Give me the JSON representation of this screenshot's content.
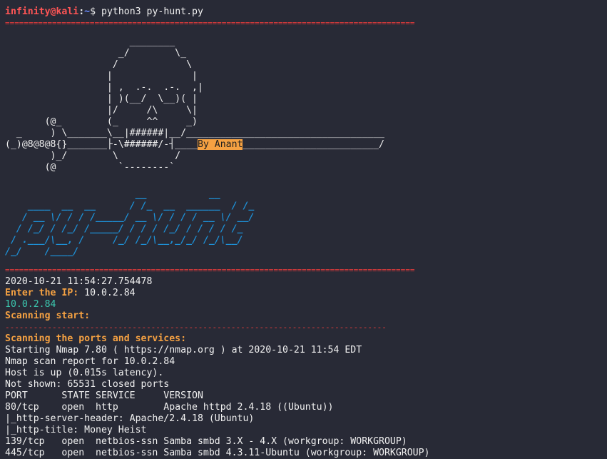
{
  "prompt": {
    "user_host": "infinity@kali",
    "separator": ":",
    "path": "~",
    "symbol": "$ ",
    "command": "python3 py-hunt.py"
  },
  "separator_line": "=======================================================================================",
  "skull_art": {
    "l1": "                      ________",
    "l2": "                    _/        \\_",
    "l3": "                   /            \\",
    "l4": "                  |              |",
    "l5": "                  | ,  .-.  .-.  ,|",
    "l6": "                  | )(__/  \\__)( |",
    "l7": "                  |/     /\\     \\|",
    "l8": "       (@_        (_     ^^     _)",
    "l9_left": "  _     ) \\_______\\__|######|__/_",
    "l9_right": "__________________________________",
    "l10_left": "(_)@8@8@8{}_______├-\\######/-┤____",
    "by_label": "By Anant",
    "l10_right": "________________________/",
    "l11": "        )_/        \\          /",
    "l12": "       (@           `--------`"
  },
  "logo_art": {
    "l1": "                       __           __",
    "l2": "    ____  __  __      / /_  __  ______  / /_",
    "l3": "   / __ \\/ / / /_____/ __ \\/ / / / __ \\/ __/",
    "l4": "  / /_/ / /_/ /_____/ / / / /_/ / / / / /_",
    "l5": " / .___/\\__, /     /_/ /_/\\__,_/_/ /_/\\__/",
    "l6": "/_/    /____/"
  },
  "output": {
    "timestamp": "2020-10-21 11:54:27.754478",
    "enter_ip_label": "Enter the IP:",
    "entered_ip": " 10.0.2.84",
    "echo_ip": "10.0.2.84",
    "scanning_start": "Scanning start:",
    "dash_line": "---------------------------------------------------------------------------------",
    "scanning_ports": "Scanning the ports and services:",
    "nmap_lines": [
      "Starting Nmap 7.80 ( https://nmap.org ) at 2020-10-21 11:54 EDT",
      "Nmap scan report for 10.0.2.84",
      "Host is up (0.015s latency).",
      "Not shown: 65531 closed ports",
      "PORT      STATE SERVICE     VERSION",
      "80/tcp    open  http        Apache httpd 2.4.18 ((Ubuntu))",
      "|_http-server-header: Apache/2.4.18 (Ubuntu)",
      "|_http-title: Money Heist",
      "139/tcp   open  netbios-ssn Samba smbd 3.X - 4.X (workgroup: WORKGROUP)",
      "445/tcp   open  netbios-ssn Samba smbd 4.3.11-Ubuntu (workgroup: WORKGROUP)"
    ]
  },
  "colors": {
    "background": "#282a36",
    "text": "#f0f0f0",
    "prompt_user": "#ff5555",
    "prompt_path": "#6b8cff",
    "separator": "#e23b3b",
    "accent_orange": "#f5a142",
    "accent_teal": "#3cc9b0",
    "logo_blue": "#1e90d6"
  }
}
